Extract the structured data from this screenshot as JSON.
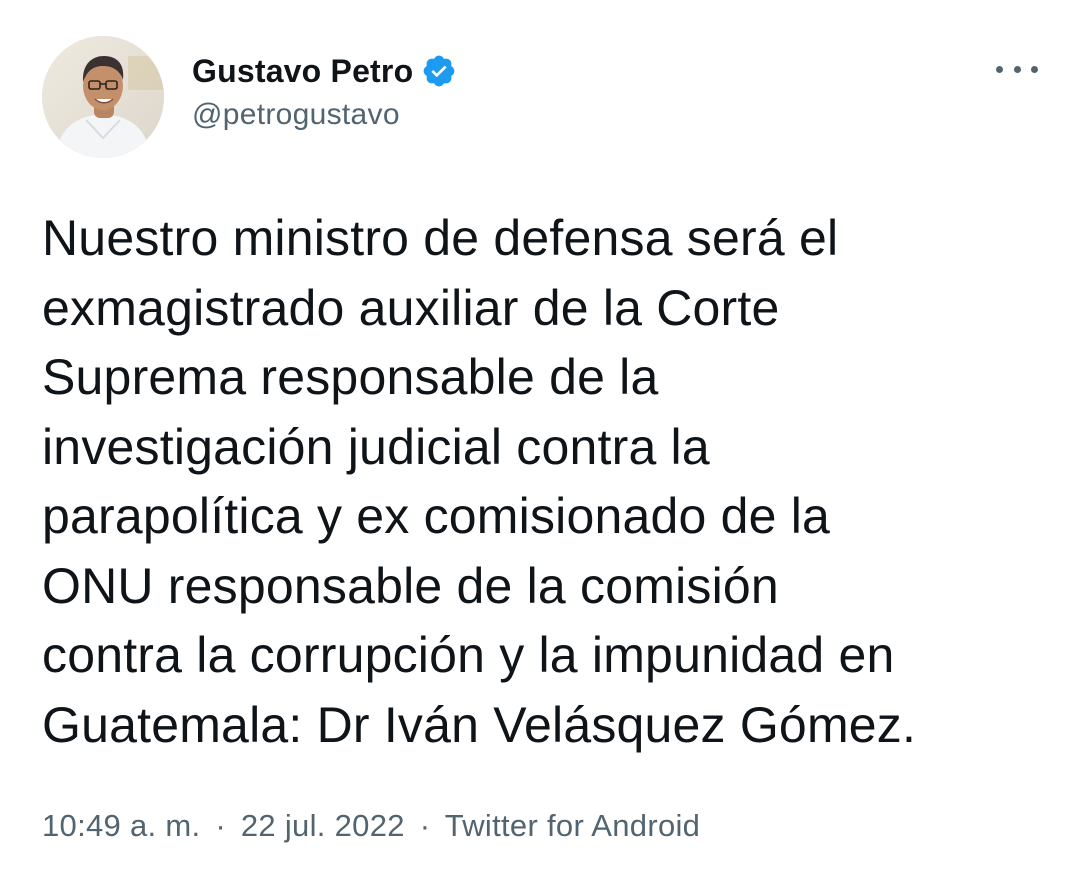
{
  "author": {
    "display_name": "Gustavo Petro",
    "handle": "@petrogustavo",
    "verified": true,
    "avatar_icon": "profile-photo",
    "verified_icon": "verified-badge-icon",
    "verified_color": "#1d9bf0"
  },
  "menu": {
    "icon": "more-options-icon"
  },
  "tweet": {
    "lines": [
      "Nuestro ministro de defensa será el",
      "exmagistrado auxiliar de la Corte",
      "Suprema responsable de la",
      "investigación judicial contra la",
      "parapolítica y ex comisionado de la",
      "ONU responsable de la comisión",
      "contra la corrupción y la impunidad en",
      "Guatemala: Dr Iván Velásquez Gómez."
    ]
  },
  "meta": {
    "time": "10:49 a. m.",
    "separator": "·",
    "date": "22 jul. 2022",
    "source": "Twitter for Android"
  },
  "colors": {
    "text_primary": "#0f1419",
    "text_secondary": "#536471",
    "background": "#ffffff"
  }
}
